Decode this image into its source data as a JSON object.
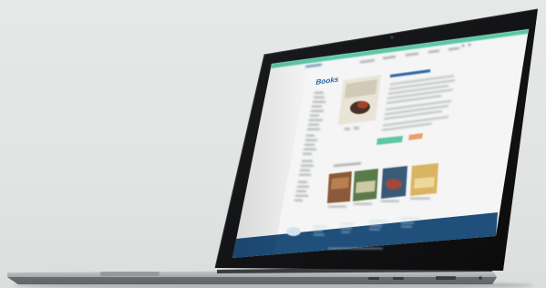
{
  "scene": {
    "subject": "laptop",
    "view": "angled-perspective",
    "background_color": "#e4e6e5"
  },
  "website": {
    "accent_color": "#5cc7a6",
    "footer_color": "#1f4f7a",
    "sidebar": {
      "title": "Books",
      "title_color": "#2f6aa8"
    },
    "product": {
      "primary_button_color": "#5cc7a6",
      "secondary_button_color": "#e7a06a"
    },
    "related": {
      "book_cover_colors": [
        "#8a5a3a",
        "#5b7a4a",
        "#3a5a7a",
        "#d9b463"
      ]
    }
  }
}
